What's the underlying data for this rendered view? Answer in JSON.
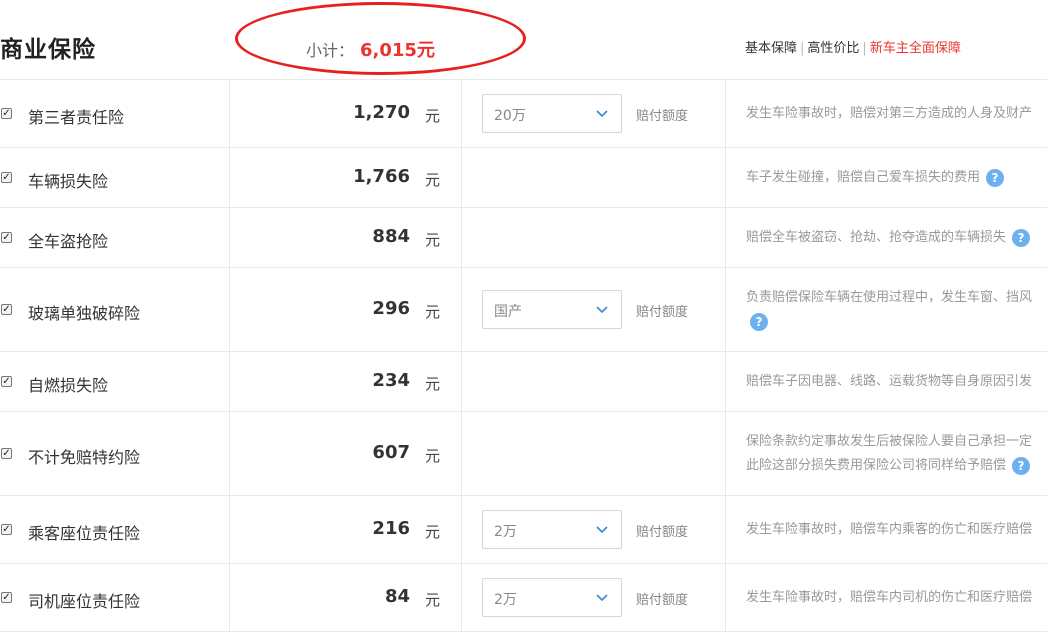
{
  "header": {
    "title": "商业保险",
    "subtotal_label": "小计：",
    "subtotal_value": "6,015元",
    "plans": [
      "基本保障",
      "高性价比",
      "新车主全面保障"
    ]
  },
  "colors": {
    "accent": "#e8352f",
    "help_icon": "#6db0f0",
    "annotation": "#e8201c"
  },
  "rows": [
    {
      "name": "第三者责任险",
      "checked": true,
      "price": "1,270",
      "unit": "元",
      "select": "20万",
      "select_label": "赔付额度",
      "desc": [
        "发生车险事故时，赔偿对第三方造成的人身及财产"
      ],
      "help": false
    },
    {
      "name": "车辆损失险",
      "checked": true,
      "price": "1,766",
      "unit": "元",
      "desc": [
        "车子发生碰撞，赔偿自己爱车损失的费用"
      ],
      "help": true
    },
    {
      "name": "全车盗抢险",
      "checked": true,
      "price": "884",
      "unit": "元",
      "desc": [
        "赔偿全车被盗窃、抢劫、抢夺造成的车辆损失"
      ],
      "help": true
    },
    {
      "name": "玻璃单独破碎险",
      "checked": true,
      "price": "296",
      "unit": "元",
      "select": "国产",
      "select_label": "赔付额度",
      "desc": [
        "负责赔偿保险车辆在使用过程中，发生车窗、挡风"
      ],
      "help": true
    },
    {
      "name": "自燃损失险",
      "checked": true,
      "price": "234",
      "unit": "元",
      "desc": [
        "赔偿车子因电器、线路、运载货物等自身原因引发"
      ],
      "help": false
    },
    {
      "name": "不计免赔特约险",
      "checked": true,
      "price": "607",
      "unit": "元",
      "desc": [
        "保险条款约定事故发生后被保险人要自己承担一定",
        "此险这部分损失费用保险公司将同样给予赔偿"
      ],
      "help": true
    },
    {
      "name": "乘客座位责任险",
      "checked": true,
      "price": "216",
      "unit": "元",
      "select": "2万",
      "select_label": "赔付额度",
      "desc": [
        "发生车险事故时，赔偿车内乘客的伤亡和医疗赔偿"
      ],
      "help": false
    },
    {
      "name": "司机座位责任险",
      "checked": true,
      "price": "84",
      "unit": "元",
      "select": "2万",
      "select_label": "赔付额度",
      "desc": [
        "发生车险事故时，赔偿车内司机的伤亡和医疗赔偿"
      ],
      "help": false
    }
  ]
}
